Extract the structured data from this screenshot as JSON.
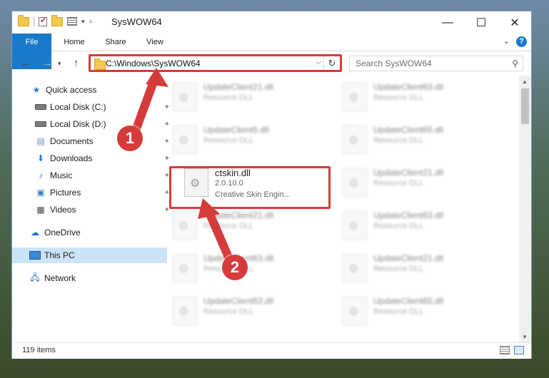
{
  "window": {
    "title": "SysWOW64",
    "controls": {
      "minimize": "—",
      "maximize": "☐",
      "close": "✕"
    }
  },
  "ribbon": {
    "tabs": [
      "File",
      "Home",
      "Share",
      "View"
    ],
    "help": "?"
  },
  "address": {
    "path": "C:\\Windows\\SysWOW64",
    "search_placeholder": "Search SysWOW64"
  },
  "navpane": {
    "items": [
      {
        "label": "Quick access",
        "icon": "star-icon"
      },
      {
        "label": "Local Disk (C:)",
        "icon": "drive-icon"
      },
      {
        "label": "Local Disk (D:)",
        "icon": "drive-icon"
      },
      {
        "label": "Documents",
        "icon": "documents-icon"
      },
      {
        "label": "Downloads",
        "icon": "download-icon"
      },
      {
        "label": "Music",
        "icon": "music-icon"
      },
      {
        "label": "Pictures",
        "icon": "pictures-icon"
      },
      {
        "label": "Videos",
        "icon": "videos-icon"
      },
      {
        "label": "OneDrive",
        "icon": "cloud-icon"
      },
      {
        "label": "This PC",
        "icon": "pc-icon",
        "selected": true
      },
      {
        "label": "Network",
        "icon": "network-icon"
      }
    ]
  },
  "files": [
    {
      "name": "UpdateClient21.dll",
      "type": "Resource DLL"
    },
    {
      "name": "UpdateClient63.dll",
      "type": "Resource DLL"
    },
    {
      "name": "UpdateClient5.dll",
      "type": "Resource DLL"
    },
    {
      "name": "UpdateClient65.dll",
      "type": "Resource DLL"
    },
    {
      "name": "ctskin.dll",
      "type": "2.0.10.0",
      "description": "Creative Skin Engin..."
    },
    {
      "name": "UpdateClient21.dll",
      "type": "Resource DLL"
    },
    {
      "name": "UpdateClient21.dll",
      "type": "Resource DLL"
    },
    {
      "name": "UpdateClient63.dll",
      "type": "Resource DLL"
    },
    {
      "name": "UpdateClient63.dll",
      "type": "Resource DLL"
    },
    {
      "name": "UpdateClient21.dll",
      "type": "Resource DLL"
    },
    {
      "name": "UpdateClient63.dll",
      "type": "Resource DLL"
    },
    {
      "name": "UpdateClient65.dll",
      "type": "Resource DLL"
    }
  ],
  "status": {
    "count": "119 items"
  },
  "callouts": [
    "1",
    "2"
  ],
  "colors": {
    "accent": "#1979ca",
    "highlight": "#d63b3b"
  }
}
